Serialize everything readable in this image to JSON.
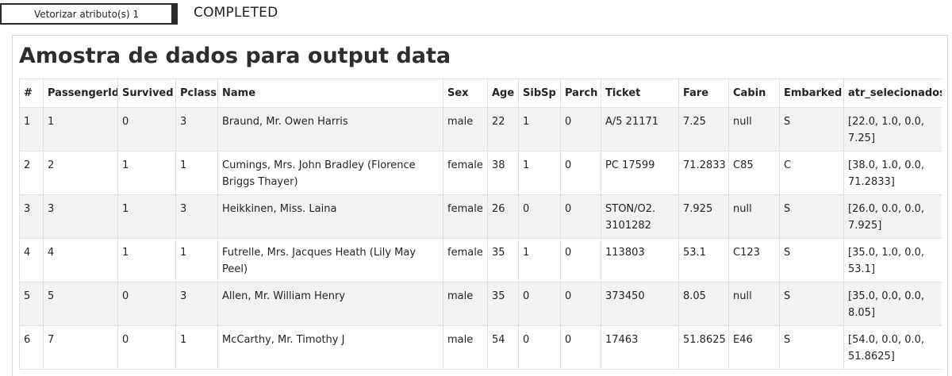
{
  "task": {
    "button_label": "Vetorizar atributo(s) 1",
    "status": "COMPLETED"
  },
  "panel": {
    "title": "Amostra de dados para output data"
  },
  "table": {
    "columns": [
      "#",
      "PassengerId",
      "Survived",
      "Pclass",
      "Name",
      "Sex",
      "Age",
      "SibSp",
      "Parch",
      "Ticket",
      "Fare",
      "Cabin",
      "Embarked",
      "atr_selecionados"
    ],
    "rows": [
      [
        "1",
        "1",
        "0",
        "3",
        "Braund, Mr. Owen Harris",
        "male",
        "22",
        "1",
        "0",
        "A/5 21171",
        "7.25",
        "null",
        "S",
        "[22.0, 1.0, 0.0, 7.25]"
      ],
      [
        "2",
        "2",
        "1",
        "1",
        "Cumings, Mrs. John Bradley (Florence Briggs Thayer)",
        "female",
        "38",
        "1",
        "0",
        "PC 17599",
        "71.2833",
        "C85",
        "C",
        "[38.0, 1.0, 0.0, 71.2833]"
      ],
      [
        "3",
        "3",
        "1",
        "3",
        "Heikkinen, Miss. Laina",
        "female",
        "26",
        "0",
        "0",
        "STON/O2. 3101282",
        "7.925",
        "null",
        "S",
        "[26.0, 0.0, 0.0, 7.925]"
      ],
      [
        "4",
        "4",
        "1",
        "1",
        "Futrelle, Mrs. Jacques Heath (Lily May Peel)",
        "female",
        "35",
        "1",
        "0",
        "113803",
        "53.1",
        "C123",
        "S",
        "[35.0, 1.0, 0.0, 53.1]"
      ],
      [
        "5",
        "5",
        "0",
        "3",
        "Allen, Mr. William Henry",
        "male",
        "35",
        "0",
        "0",
        "373450",
        "8.05",
        "null",
        "S",
        "[35.0, 0.0, 0.0, 8.05]"
      ],
      [
        "6",
        "7",
        "0",
        "1",
        "McCarthy, Mr. Timothy J",
        "male",
        "54",
        "0",
        "0",
        "17463",
        "51.8625",
        "E46",
        "S",
        "[54.0, 0.0, 0.0, 51.8625]"
      ]
    ]
  }
}
